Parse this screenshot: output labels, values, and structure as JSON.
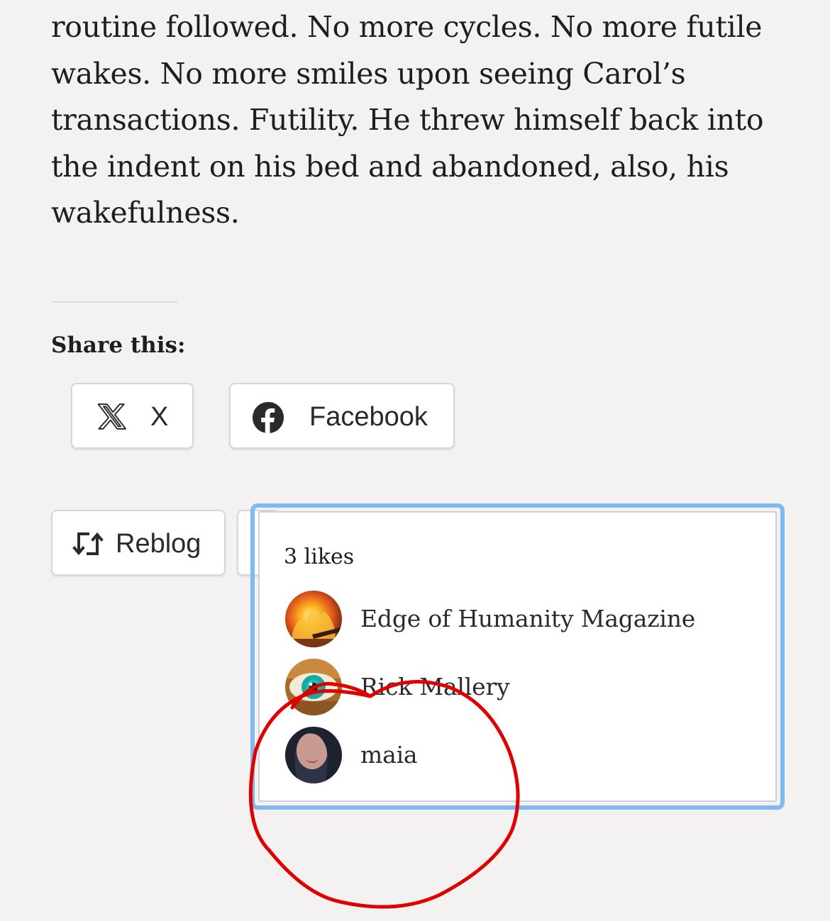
{
  "article": {
    "paragraph": "routine followed. No more cycles. No more futile wakes. No more smiles upon seeing Carol’s transactions. Futility. He threw himself back into the indent on his bed and abandoned, also, his wakefulness."
  },
  "share": {
    "heading": "Share this:",
    "buttons": {
      "x_label": "X",
      "facebook_label": "Facebook"
    }
  },
  "actions": {
    "reblog_label": "Reblog"
  },
  "likes": {
    "count_label": "3 likes",
    "likers": [
      {
        "name": "Edge of Humanity Magazine",
        "avatar": "fire-avatar"
      },
      {
        "name": "Rick Mallery",
        "avatar": "eye-avatar"
      },
      {
        "name": "maia",
        "avatar": "portrait-avatar"
      }
    ]
  },
  "colors": {
    "page_background": "#f3f2f1",
    "popover_focus_ring": "#80b8f0",
    "annotation_circle": "#e00000",
    "text": "#1e1e1e"
  }
}
